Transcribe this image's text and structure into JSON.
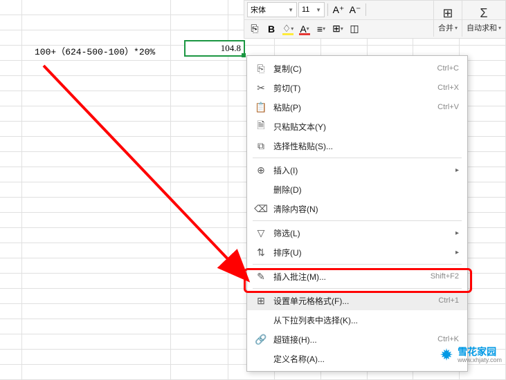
{
  "toolbar": {
    "font_name": "宋体",
    "font_size": "11",
    "merge_label": "合并",
    "autosum_label": "自动求和"
  },
  "cell": {
    "formula": "100+（624-500-100）*20%",
    "value": "104.8"
  },
  "menu": {
    "copy": "复制(C)",
    "copy_sc": "Ctrl+C",
    "cut": "剪切(T)",
    "cut_sc": "Ctrl+X",
    "paste": "粘贴(P)",
    "paste_sc": "Ctrl+V",
    "paste_text": "只粘贴文本(Y)",
    "paste_special": "选择性粘贴(S)...",
    "insert": "插入(I)",
    "delete": "删除(D)",
    "clear": "清除内容(N)",
    "filter": "筛选(L)",
    "sort": "排序(U)",
    "comment": "插入批注(M)...",
    "comment_sc": "Shift+F2",
    "format": "设置单元格格式(F)...",
    "format_sc": "Ctrl+1",
    "dropdown": "从下拉列表中选择(K)...",
    "hyperlink": "超链接(H)...",
    "hyperlink_sc": "Ctrl+K",
    "define_name": "定义名称(A)..."
  },
  "watermark": {
    "title": "雪花家园",
    "url": "www.xhjaty.com"
  }
}
